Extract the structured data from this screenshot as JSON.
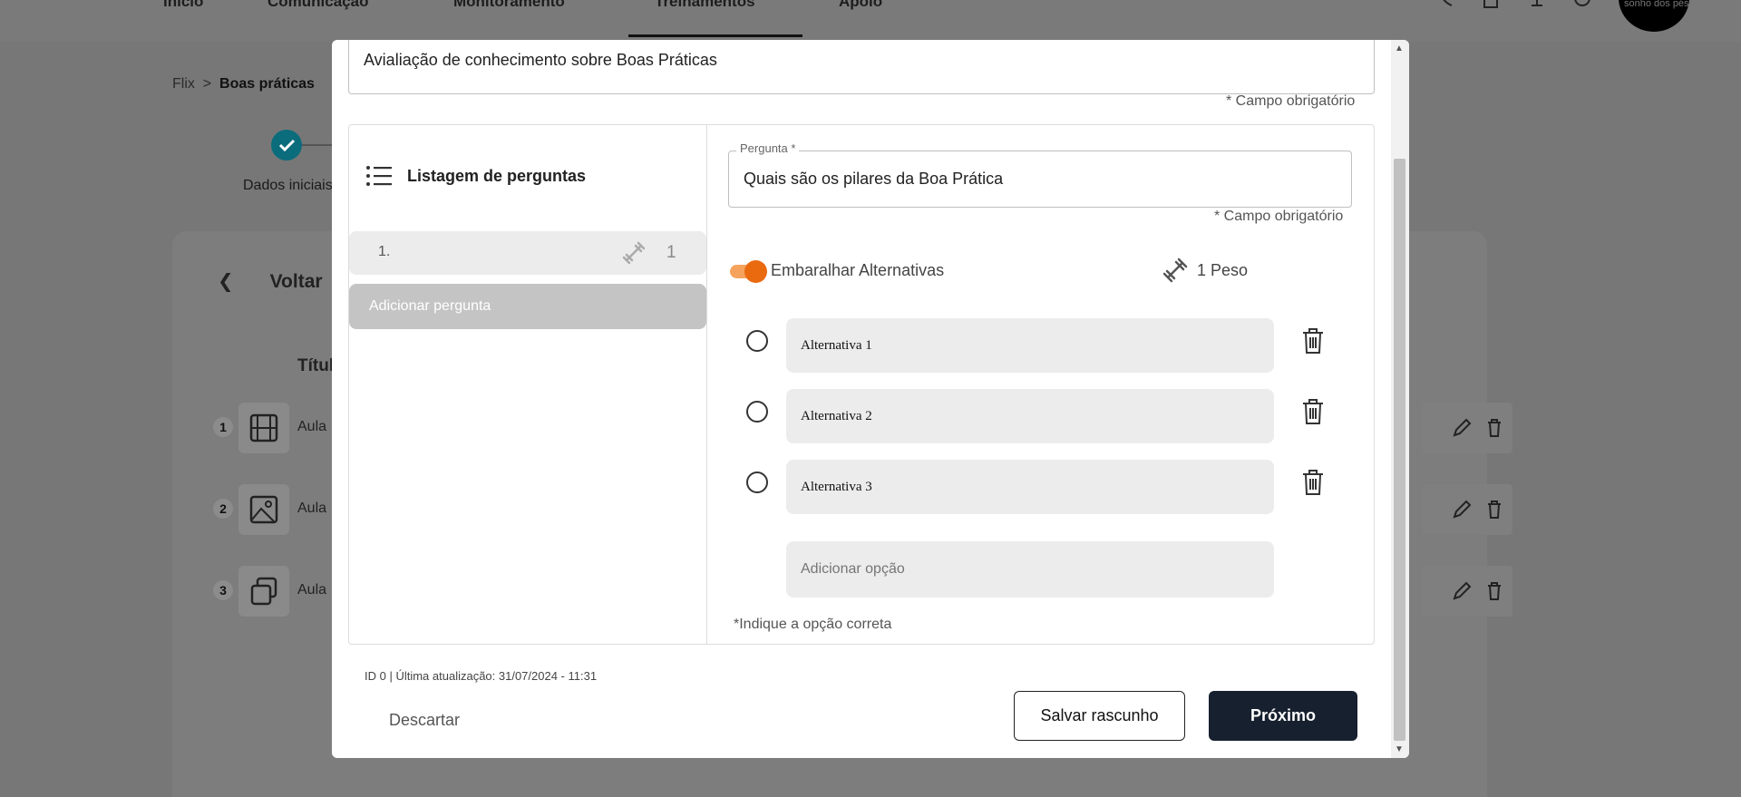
{
  "background": {
    "nav": {
      "items": [
        "Início",
        "Comunicação",
        "Monitoramento",
        "Treinamentos",
        "Apoio"
      ],
      "avatar_text": "sonho dos pés"
    },
    "breadcrumb": {
      "root": "Flix",
      "separator": ">",
      "current": "Boas práticas"
    },
    "stepper": {
      "step_label": "Dados iniciais"
    },
    "back_label": "Voltar",
    "column_title": "Títul",
    "rows": [
      {
        "num": "1",
        "label": "Aula",
        "icon": "film-icon"
      },
      {
        "num": "2",
        "label": "Aula",
        "icon": "image-icon"
      },
      {
        "num": "3",
        "label": "Aula",
        "icon": "gallery-icon"
      }
    ]
  },
  "modal": {
    "title_value": "Avialiação de conhecimento sobre Boas Práticas",
    "required_note": "* Campo obrigatório",
    "question_list": {
      "heading": "Listagem de perguntas",
      "items": [
        {
          "number": "1.",
          "weight": "1"
        }
      ],
      "add_label": "Adicionar pergunta"
    },
    "question": {
      "label": "Pergunta *",
      "value": "Quais são os pilares da Boa Prática",
      "required_note": "* Campo obrigatório",
      "shuffle_label": "Embaralhar Alternativas",
      "shuffle_on": true,
      "weight_label": "1 Peso",
      "alternatives": [
        "Alternativa 1",
        "Alternativa 2",
        "Alternativa 3"
      ],
      "add_option_placeholder": "Adicionar opção",
      "hint": "*Indique a opção correta"
    },
    "meta": "ID 0 | Última atualização: 31/07/2024 - 11:31",
    "buttons": {
      "discard": "Descartar",
      "save_draft": "Salvar rascunho",
      "next": "Próximo"
    }
  },
  "colors": {
    "accent_orange": "#ea6a10",
    "primary_dark": "#17202e",
    "step_teal": "#0b6c7c"
  }
}
